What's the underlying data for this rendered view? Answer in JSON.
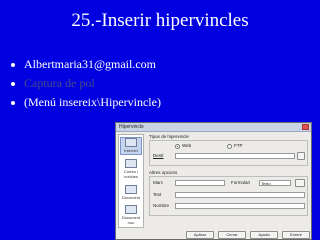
{
  "slide": {
    "title": "25.-Inserir hipervincles",
    "bullets": [
      {
        "text": "Albertmaria31@gmail.com",
        "dim": false
      },
      {
        "text": "Captura de pol",
        "dim": true
      },
      {
        "text": "(Menú insereix\\Hipervincle)",
        "dim": false
      }
    ]
  },
  "dialog": {
    "title": "Hipervincle",
    "sidebar": [
      {
        "label": "Internet"
      },
      {
        "label": "Correu i notícies"
      },
      {
        "label": "Document"
      },
      {
        "label": "Document nou"
      }
    ],
    "hyperlink_type": {
      "label": "Tipus de hipervincle",
      "options": [
        "Web",
        "FTP"
      ],
      "selected": "Web",
      "target_label": "Destí"
    },
    "other_options": {
      "label": "Altres opcions",
      "frame_label": "Marc",
      "form_label": "Formulari",
      "form_value": "Texto",
      "text_label": "Text",
      "name_label": "Nombre"
    },
    "buttons": [
      "Aplicar",
      "Cerrar",
      "Ayuda",
      "Enrere"
    ]
  },
  "colors": {
    "background": "#0000e0",
    "text": "#ffffff"
  }
}
